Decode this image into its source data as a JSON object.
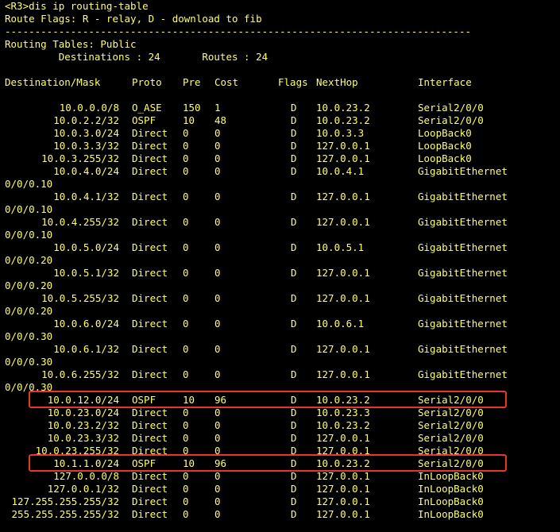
{
  "terminal": {
    "prompt_line": "<R3>dis ip routing-table",
    "flags_line": "Route Flags: R - relay, D - download to fib",
    "separator": "------------------------------------------------------------------------------",
    "tables_line": "Routing Tables: Public",
    "destinations_line": "         Destinations : 24       Routes : 24",
    "header": {
      "destination": "Destination/Mask",
      "proto": "Proto",
      "pre": "Pre",
      "cost": "Cost",
      "flags": "Flags",
      "nexthop": "NextHop",
      "interface": "Interface"
    },
    "routes": [
      {
        "dest": "10.0.0.0/8",
        "proto": "O_ASE",
        "pre": "150",
        "cost": "1",
        "flags": "D",
        "nexthop": "10.0.23.2",
        "iface": "Serial2/0/0",
        "wrap": ""
      },
      {
        "dest": "10.0.2.2/32",
        "proto": "OSPF",
        "pre": "10",
        "cost": "48",
        "flags": "D",
        "nexthop": "10.0.23.2",
        "iface": "Serial2/0/0",
        "wrap": ""
      },
      {
        "dest": "10.0.3.0/24",
        "proto": "Direct",
        "pre": "0",
        "cost": "0",
        "flags": "D",
        "nexthop": "10.0.3.3",
        "iface": "LoopBack0",
        "wrap": ""
      },
      {
        "dest": "10.0.3.3/32",
        "proto": "Direct",
        "pre": "0",
        "cost": "0",
        "flags": "D",
        "nexthop": "127.0.0.1",
        "iface": "LoopBack0",
        "wrap": ""
      },
      {
        "dest": "10.0.3.255/32",
        "proto": "Direct",
        "pre": "0",
        "cost": "0",
        "flags": "D",
        "nexthop": "127.0.0.1",
        "iface": "LoopBack0",
        "wrap": ""
      },
      {
        "dest": "10.0.4.0/24",
        "proto": "Direct",
        "pre": "0",
        "cost": "0",
        "flags": "D",
        "nexthop": "10.0.4.1",
        "iface": "GigabitEthernet",
        "wrap": "0/0/0.10"
      },
      {
        "dest": "10.0.4.1/32",
        "proto": "Direct",
        "pre": "0",
        "cost": "0",
        "flags": "D",
        "nexthop": "127.0.0.1",
        "iface": "GigabitEthernet",
        "wrap": "0/0/0.10"
      },
      {
        "dest": "10.0.4.255/32",
        "proto": "Direct",
        "pre": "0",
        "cost": "0",
        "flags": "D",
        "nexthop": "127.0.0.1",
        "iface": "GigabitEthernet",
        "wrap": "0/0/0.10"
      },
      {
        "dest": "10.0.5.0/24",
        "proto": "Direct",
        "pre": "0",
        "cost": "0",
        "flags": "D",
        "nexthop": "10.0.5.1",
        "iface": "GigabitEthernet",
        "wrap": "0/0/0.20"
      },
      {
        "dest": "10.0.5.1/32",
        "proto": "Direct",
        "pre": "0",
        "cost": "0",
        "flags": "D",
        "nexthop": "127.0.0.1",
        "iface": "GigabitEthernet",
        "wrap": "0/0/0.20"
      },
      {
        "dest": "10.0.5.255/32",
        "proto": "Direct",
        "pre": "0",
        "cost": "0",
        "flags": "D",
        "nexthop": "127.0.0.1",
        "iface": "GigabitEthernet",
        "wrap": "0/0/0.20"
      },
      {
        "dest": "10.0.6.0/24",
        "proto": "Direct",
        "pre": "0",
        "cost": "0",
        "flags": "D",
        "nexthop": "10.0.6.1",
        "iface": "GigabitEthernet",
        "wrap": "0/0/0.30"
      },
      {
        "dest": "10.0.6.1/32",
        "proto": "Direct",
        "pre": "0",
        "cost": "0",
        "flags": "D",
        "nexthop": "127.0.0.1",
        "iface": "GigabitEthernet",
        "wrap": "0/0/0.30"
      },
      {
        "dest": "10.0.6.255/32",
        "proto": "Direct",
        "pre": "0",
        "cost": "0",
        "flags": "D",
        "nexthop": "127.0.0.1",
        "iface": "GigabitEthernet",
        "wrap": "0/0/0.30"
      },
      {
        "dest": "10.0.12.0/24",
        "proto": "OSPF",
        "pre": "10",
        "cost": "96",
        "flags": "D",
        "nexthop": "10.0.23.2",
        "iface": "Serial2/0/0",
        "wrap": ""
      },
      {
        "dest": "10.0.23.0/24",
        "proto": "Direct",
        "pre": "0",
        "cost": "0",
        "flags": "D",
        "nexthop": "10.0.23.3",
        "iface": "Serial2/0/0",
        "wrap": ""
      },
      {
        "dest": "10.0.23.2/32",
        "proto": "Direct",
        "pre": "0",
        "cost": "0",
        "flags": "D",
        "nexthop": "10.0.23.2",
        "iface": "Serial2/0/0",
        "wrap": ""
      },
      {
        "dest": "10.0.23.3/32",
        "proto": "Direct",
        "pre": "0",
        "cost": "0",
        "flags": "D",
        "nexthop": "127.0.0.1",
        "iface": "Serial2/0/0",
        "wrap": ""
      },
      {
        "dest": "10.0.23.255/32",
        "proto": "Direct",
        "pre": "0",
        "cost": "0",
        "flags": "D",
        "nexthop": "127.0.0.1",
        "iface": "Serial2/0/0",
        "wrap": ""
      },
      {
        "dest": "10.1.1.0/24",
        "proto": "OSPF",
        "pre": "10",
        "cost": "96",
        "flags": "D",
        "nexthop": "10.0.23.2",
        "iface": "Serial2/0/0",
        "wrap": ""
      },
      {
        "dest": "127.0.0.0/8",
        "proto": "Direct",
        "pre": "0",
        "cost": "0",
        "flags": "D",
        "nexthop": "127.0.0.1",
        "iface": "InLoopBack0",
        "wrap": ""
      },
      {
        "dest": "127.0.0.1/32",
        "proto": "Direct",
        "pre": "0",
        "cost": "0",
        "flags": "D",
        "nexthop": "127.0.0.1",
        "iface": "InLoopBack0",
        "wrap": ""
      },
      {
        "dest": "127.255.255.255/32",
        "proto": "Direct",
        "pre": "0",
        "cost": "0",
        "flags": "D",
        "nexthop": "127.0.0.1",
        "iface": "InLoopBack0",
        "wrap": ""
      },
      {
        "dest": "255.255.255.255/32",
        "proto": "Direct",
        "pre": "0",
        "cost": "0",
        "flags": "D",
        "nexthop": "127.0.0.1",
        "iface": "InLoopBack0",
        "wrap": ""
      }
    ],
    "highlighted_routes": [
      14,
      19
    ]
  },
  "colors": {
    "background": "#000000",
    "text": "#FFFF66",
    "highlight_border": "#E8352E"
  }
}
